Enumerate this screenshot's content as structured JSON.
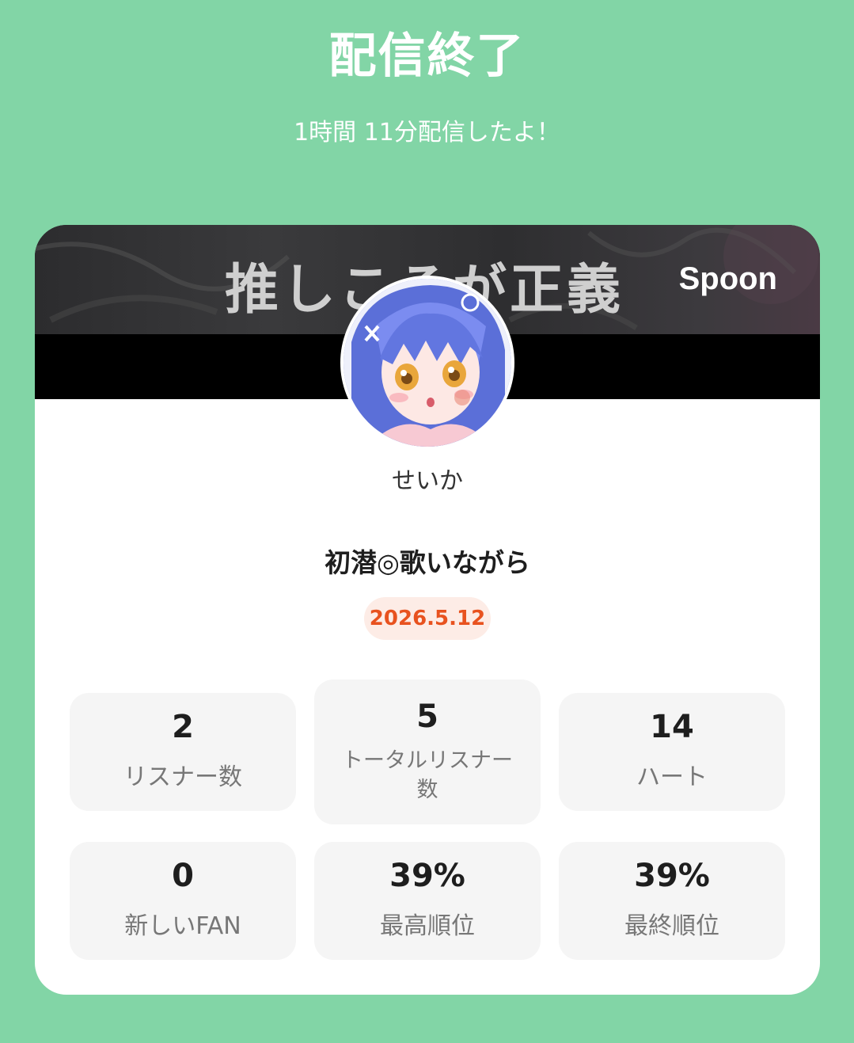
{
  "header": {
    "title": "配信終了",
    "subtitle": "1時間 11分配信したよ！"
  },
  "banner": {
    "text": "推しこそが正義",
    "logo": "Spoon"
  },
  "profile": {
    "avatar_icon": "avatar-illustration",
    "name": "せいか"
  },
  "stream": {
    "title": "初潜◎歌いながら",
    "date": "2026.5.12"
  },
  "stats": [
    {
      "value": "2",
      "label": "リスナー数"
    },
    {
      "value": "5",
      "label_line1": "トータルリスナー",
      "label_line2": "数"
    },
    {
      "value": "14",
      "label": "ハート"
    },
    {
      "value": "0",
      "label": "新しいFAN"
    },
    {
      "value": "39%",
      "label": "最高順位"
    },
    {
      "value": "39%",
      "label": "最終順位"
    }
  ],
  "colors": {
    "background": "#82d5a6",
    "card": "#ffffff",
    "date_badge_bg": "#fdece6",
    "date_badge_text": "#e8521f",
    "stat_bg": "#f5f5f5"
  }
}
